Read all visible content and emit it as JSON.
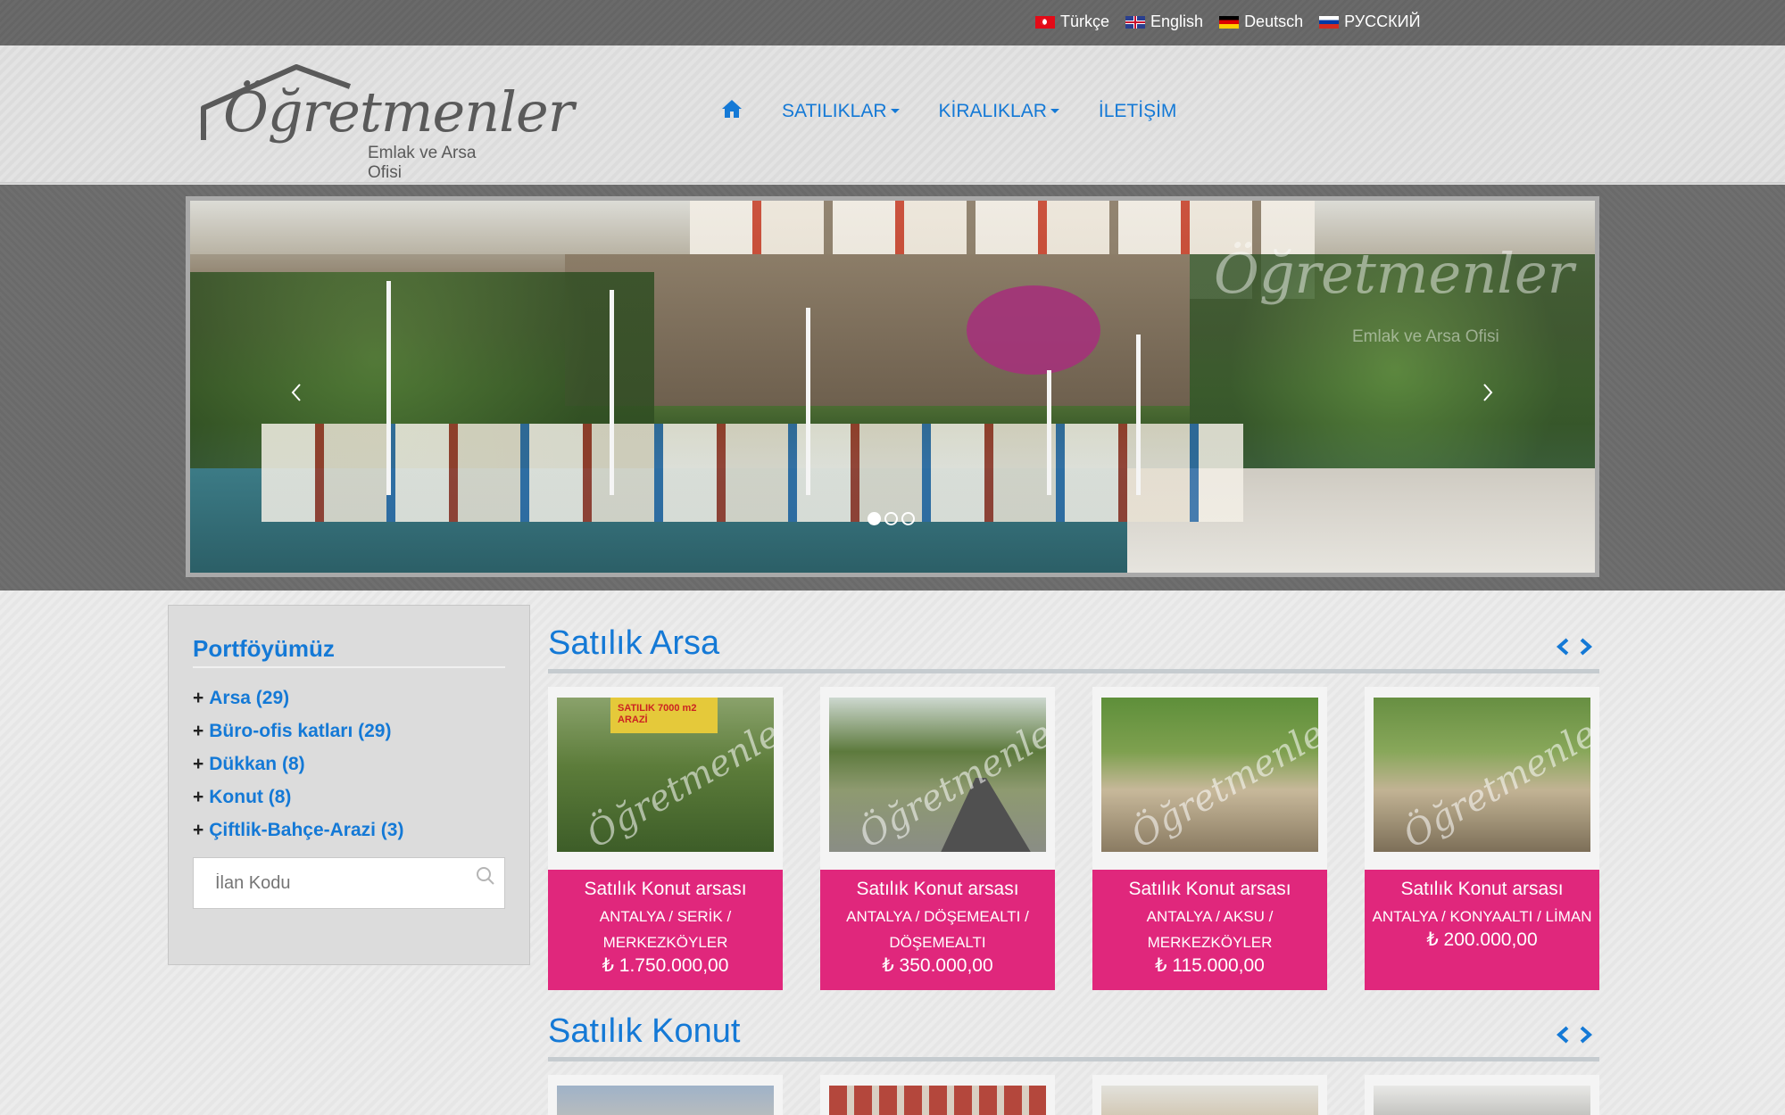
{
  "languages": [
    {
      "label": "Türkçe",
      "flag": "tr-flag-icon"
    },
    {
      "label": "English",
      "flag": "uk-flag-icon"
    },
    {
      "label": "Deutsch",
      "flag": "de-flag-icon"
    },
    {
      "label": "РУССКИЙ",
      "flag": "ru-flag-icon"
    }
  ],
  "logo": {
    "main": "Öğretmenler",
    "sub": "Emlak ve Arsa Ofisi"
  },
  "nav": {
    "home_icon": "home-icon",
    "items": [
      {
        "label": "SATILIKLAR",
        "has_dropdown": true
      },
      {
        "label": "KİRALIKLAR",
        "has_dropdown": true
      },
      {
        "label": "İLETİŞİM",
        "has_dropdown": false
      }
    ]
  },
  "slider": {
    "watermark": "Öğretmenler",
    "watermark_sub": "Emlak ve Arsa Ofisi",
    "dots": 3,
    "active_dot": 0,
    "prev_icon": "chevron-left-icon",
    "next_icon": "chevron-right-icon"
  },
  "sidebar": {
    "title": "Portföyümüz",
    "items": [
      {
        "label": "Arsa (29)"
      },
      {
        "label": "Büro-ofis katları (29)"
      },
      {
        "label": "Dükkan (8)"
      },
      {
        "label": "Konut (8)"
      },
      {
        "label": "Çiftlik-Bahçe-Arazi (3)"
      }
    ],
    "search_placeholder": "İlan Kodu"
  },
  "sections": [
    {
      "title": "Satılık Arsa",
      "cards": [
        {
          "title": "Satılık Konut arsası",
          "location": "ANTALYA / SERİK / MERKEZKÖYLER",
          "price": "₺ 1.750.000,00",
          "sign_text": "SATILIK 7000 m2 ARAZİ"
        },
        {
          "title": "Satılık Konut arsası",
          "location": "ANTALYA / DÖŞEMEALTI / DÖŞEMEALTI",
          "price": "₺ 350.000,00"
        },
        {
          "title": "Satılık Konut arsası",
          "location": "ANTALYA / AKSU / MERKEZKÖYLER",
          "price": "₺ 115.000,00"
        },
        {
          "title": "Satılık Konut arsası",
          "location": "ANTALYA / KONYAALTI / LİMAN",
          "price": "₺ 200.000,00"
        }
      ]
    },
    {
      "title": "Satılık Konut",
      "cards": [
        {},
        {},
        {},
        {}
      ]
    }
  ],
  "colors": {
    "accent": "#1479d6",
    "card_bg": "#e0277c"
  }
}
